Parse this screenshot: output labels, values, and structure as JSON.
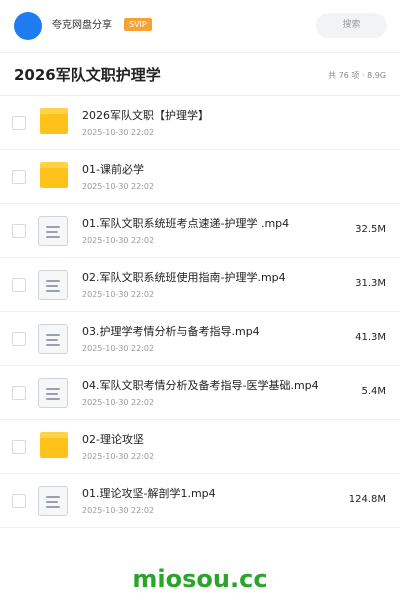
{
  "header": {
    "user_name": "夸克网盘分享",
    "badge": "SVIP",
    "search_placeholder": "搜索",
    "accent_color": "#1f7cf0",
    "badge_color": "#f7a333"
  },
  "folder": {
    "title": "2026军队文职护理学",
    "meta": "共 76 项 · 8.9G"
  },
  "files": [
    {
      "type": "folder",
      "icon": "folder-icon",
      "name": "2026军队文职【护理学】",
      "date": "2025-10-30 22:02",
      "size": ""
    },
    {
      "type": "folder",
      "icon": "folder-icon",
      "name": "01-课前必学",
      "date": "2025-10-30 22:02",
      "size": ""
    },
    {
      "type": "file",
      "icon": "document-icon",
      "name": "01.军队文职系统班考点速递-护理学 .mp4",
      "date": "2025-10-30 22:02",
      "size": "32.5M"
    },
    {
      "type": "file",
      "icon": "document-icon",
      "name": "02.军队文职系统班使用指南-护理学.mp4",
      "date": "2025-10-30 22:02",
      "size": "31.3M"
    },
    {
      "type": "file",
      "icon": "document-icon",
      "name": "03.护理学考情分析与备考指导.mp4",
      "date": "2025-10-30 22:02",
      "size": "41.3M"
    },
    {
      "type": "file",
      "icon": "document-icon",
      "name": "04.军队文职考情分析及备考指导-医学基础.mp4",
      "date": "2025-10-30 22:02",
      "size": "5.4M"
    },
    {
      "type": "folder",
      "icon": "folder-icon",
      "name": "02-理论攻坚",
      "date": "2025-10-30 22:02",
      "size": ""
    },
    {
      "type": "file",
      "icon": "document-icon",
      "name": "01.理论攻坚-解剖学1.mp4",
      "date": "2025-10-30 22:02",
      "size": "124.8M"
    }
  ],
  "watermark": "miosou.cc"
}
